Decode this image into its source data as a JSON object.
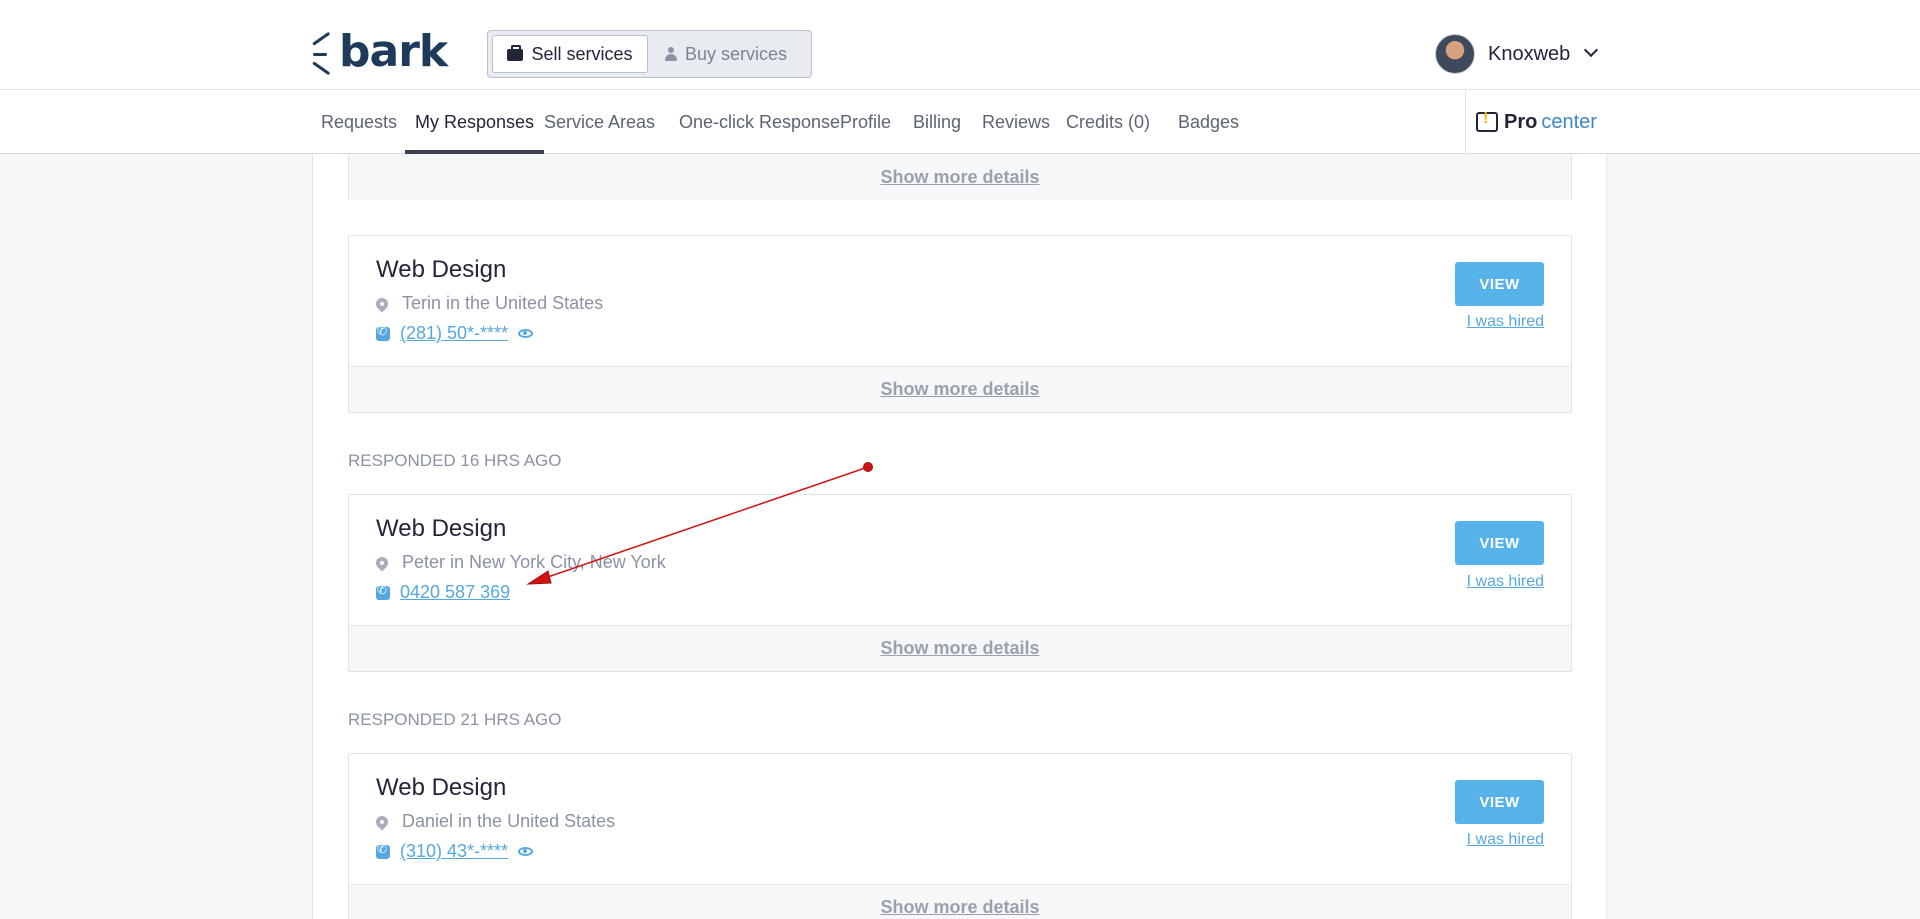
{
  "header": {
    "logo_text": "bark",
    "switcher": {
      "sell_label": "Sell services",
      "buy_label": "Buy services"
    },
    "user": {
      "name": "Knoxweb"
    }
  },
  "nav": {
    "items": [
      {
        "label": "Requests"
      },
      {
        "label": "My Responses"
      },
      {
        "label": "Service Areas"
      },
      {
        "label": "One-click Response"
      },
      {
        "label": "Profile"
      },
      {
        "label": "Billing"
      },
      {
        "label": "Reviews"
      },
      {
        "label": "Credits (0)"
      },
      {
        "label": "Badges"
      }
    ],
    "active": "My Responses",
    "pro_center": {
      "bold": "Pro",
      "rest": "center"
    }
  },
  "responses": {
    "show_more_label": "Show more details",
    "view_label": "VIEW",
    "hired_label": "I was hired",
    "items": [
      {
        "title": "Web Design",
        "location": "Terin in the United States",
        "phone": "(281) 50*-****",
        "masked": true
      },
      {
        "title": "Web Design",
        "location": "Peter in New York City, New York",
        "phone": "0420 587 369",
        "masked": false
      },
      {
        "title": "Web Design",
        "location": "Daniel in the United States",
        "phone": "(310) 43*-****",
        "masked": true
      }
    ],
    "sections": [
      {
        "label": "RESPONDED 16 HRS AGO"
      },
      {
        "label": "RESPONDED 21 HRS AGO"
      }
    ]
  },
  "colors": {
    "brand": "#1e3b5c",
    "accent": "#56b3ea",
    "link": "#56a7e0",
    "annotation": "#d01414"
  }
}
